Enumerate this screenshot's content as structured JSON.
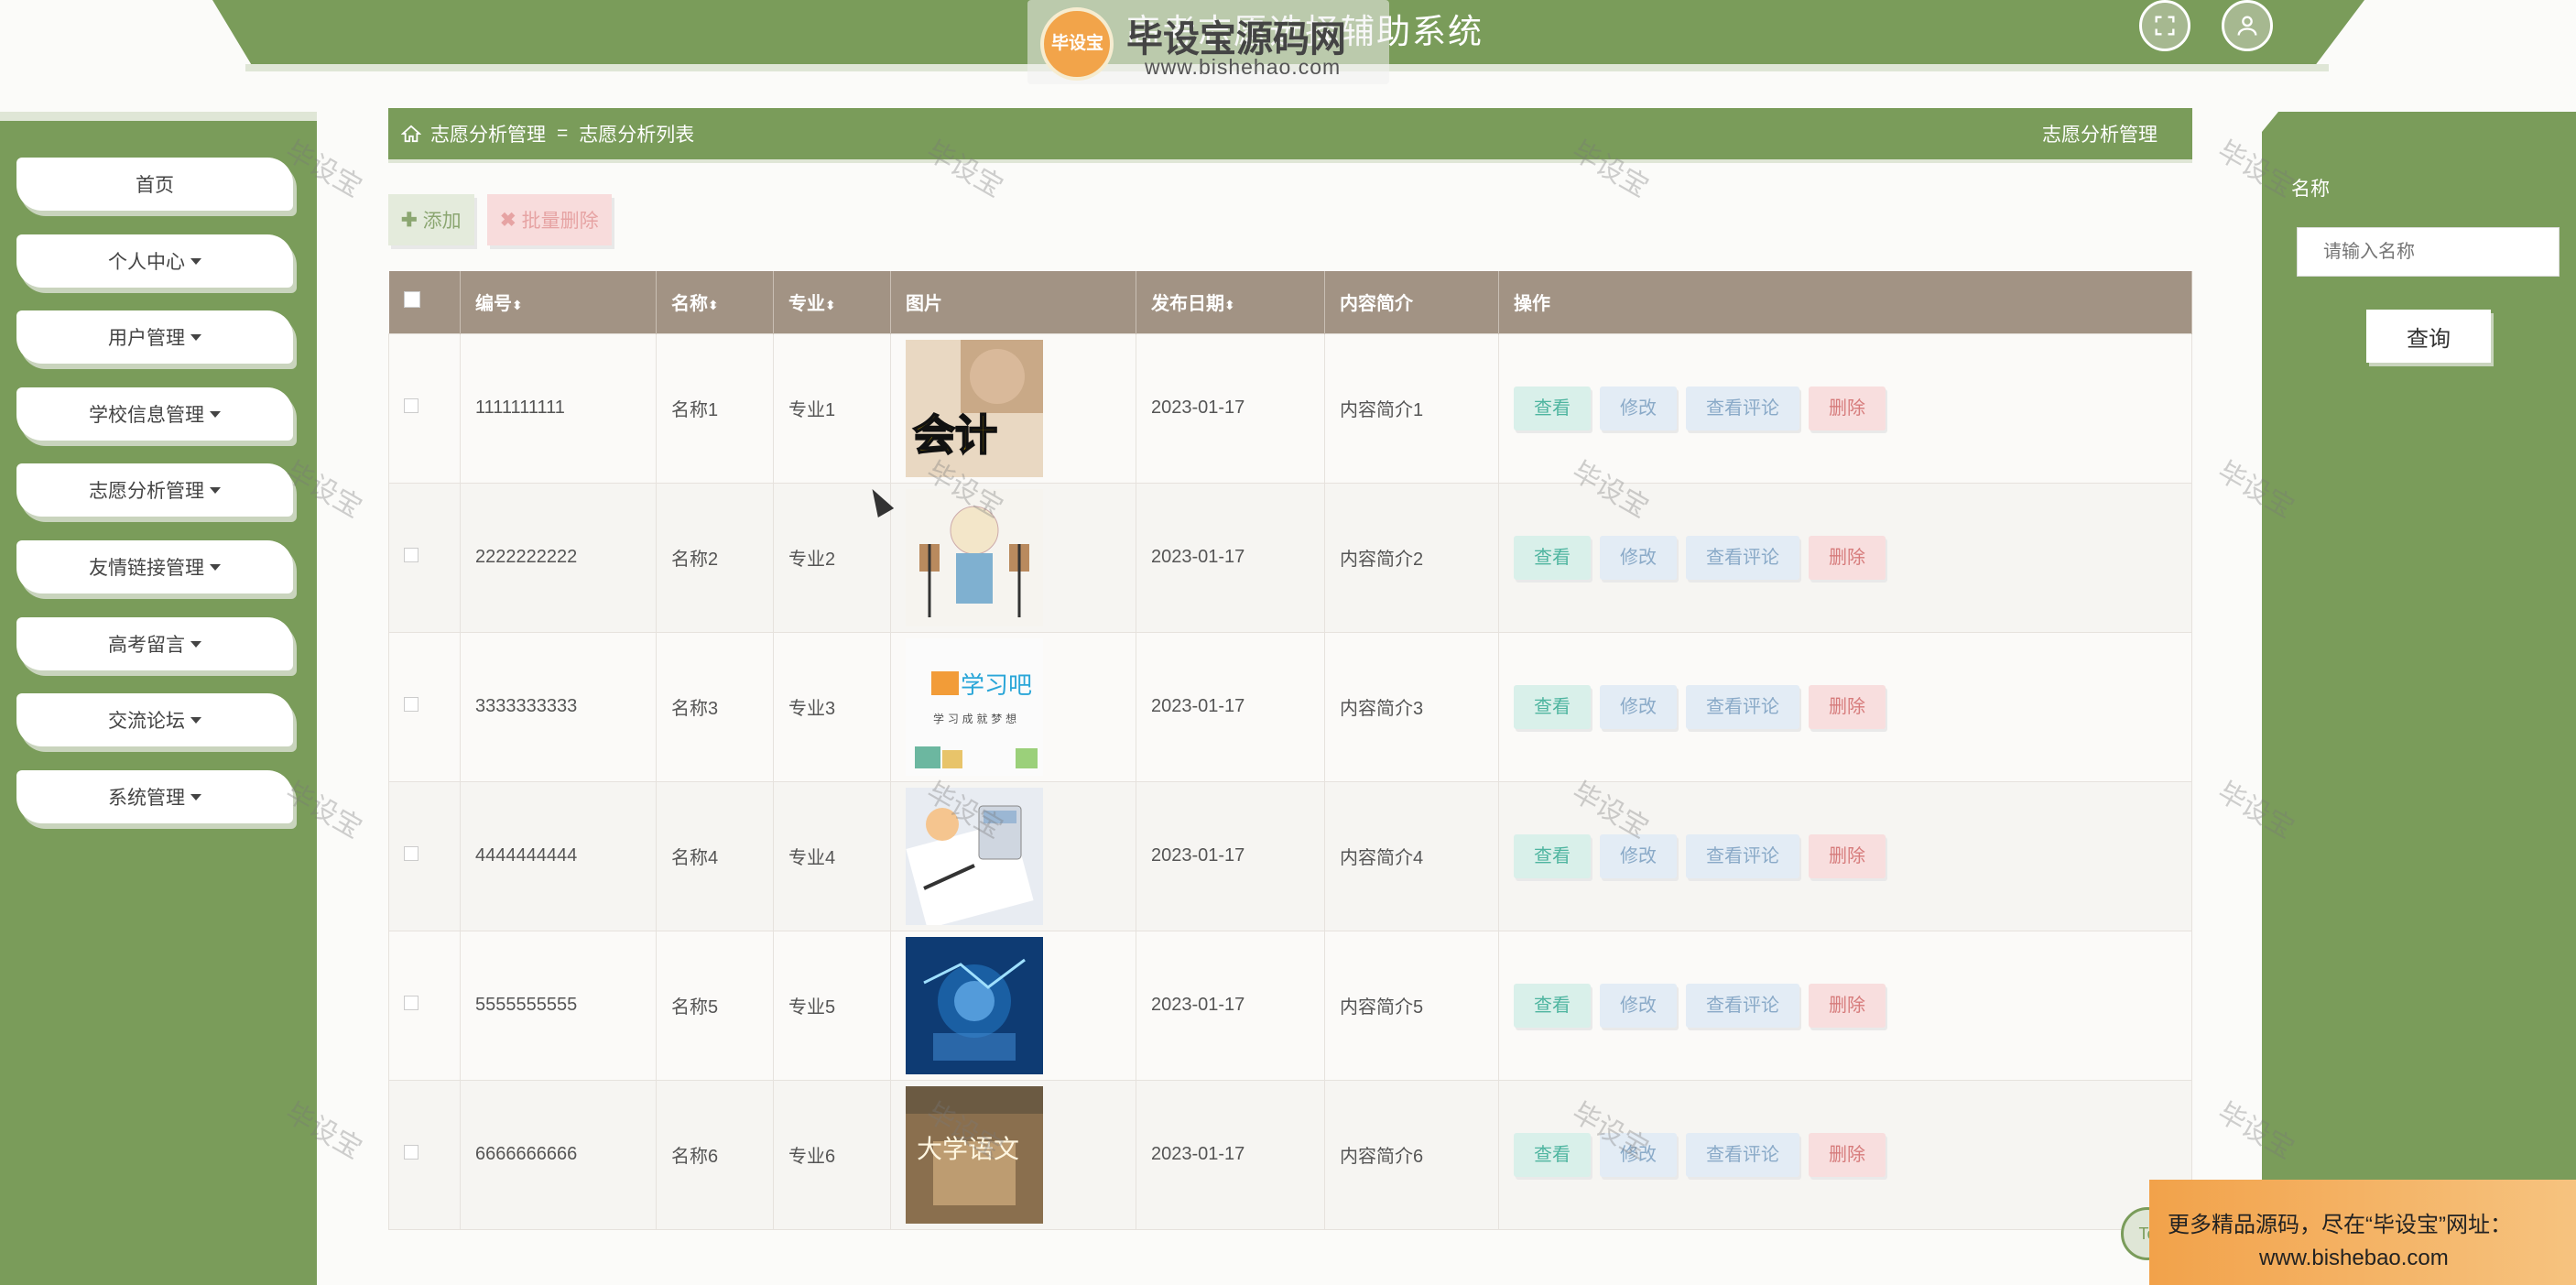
{
  "header": {
    "title": "高考志愿选择辅助系统",
    "watermark_badge": "毕设宝",
    "watermark_name": "毕设宝源码网",
    "watermark_url": "www.bishehao.com",
    "fullscreen_icon": "expand-icon",
    "user_icon": "user-icon"
  },
  "sidebar": {
    "items": [
      {
        "label": "首页",
        "has_caret": false
      },
      {
        "label": "个人中心",
        "has_caret": true
      },
      {
        "label": "用户管理",
        "has_caret": true
      },
      {
        "label": "学校信息管理",
        "has_caret": true
      },
      {
        "label": "志愿分析管理",
        "has_caret": true
      },
      {
        "label": "友情链接管理",
        "has_caret": true
      },
      {
        "label": "高考留言",
        "has_caret": true
      },
      {
        "label": "交流论坛",
        "has_caret": true
      },
      {
        "label": "系统管理",
        "has_caret": true
      }
    ]
  },
  "breadcrumb": {
    "parent": "志愿分析管理",
    "separator": "=",
    "current": "志愿分析列表",
    "right_title": "志愿分析管理"
  },
  "actions": {
    "add_label": "添加",
    "batch_delete_label": "批量删除"
  },
  "table": {
    "columns": [
      "编号",
      "名称",
      "专业",
      "图片",
      "发布日期",
      "内容简介",
      "操作"
    ],
    "rows": [
      {
        "id": "1111111111",
        "name": "名称1",
        "major": "专业1",
        "date": "2023-01-17",
        "intro": "内容简介1"
      },
      {
        "id": "2222222222",
        "name": "名称2",
        "major": "专业2",
        "date": "2023-01-17",
        "intro": "内容简介2"
      },
      {
        "id": "3333333333",
        "name": "名称3",
        "major": "专业3",
        "date": "2023-01-17",
        "intro": "内容简介3"
      },
      {
        "id": "4444444444",
        "name": "名称4",
        "major": "专业4",
        "date": "2023-01-17",
        "intro": "内容简介4"
      },
      {
        "id": "5555555555",
        "name": "名称5",
        "major": "专业5",
        "date": "2023-01-17",
        "intro": "内容简介5"
      },
      {
        "id": "6666666666",
        "name": "名称6",
        "major": "专业6",
        "date": "2023-01-17",
        "intro": "内容简介6"
      }
    ],
    "ops": {
      "view": "查看",
      "edit": "修改",
      "comments": "查看评论",
      "delete": "删除"
    },
    "thumb_texts": [
      "会计",
      "学习吧",
      "大学语文"
    ]
  },
  "search": {
    "label": "名称",
    "placeholder": "请输入名称",
    "button": "查询"
  },
  "watermark_text": "毕设宝",
  "promo": {
    "line1": "更多精品源码，尽在“毕设宝”网址：",
    "line2": "www.bishebao.com",
    "fab": "To"
  },
  "colors": {
    "primary_green": "#7a9c5a",
    "table_header": "#a29384",
    "view": "#4fb5a0",
    "delete": "#d67b7b"
  }
}
